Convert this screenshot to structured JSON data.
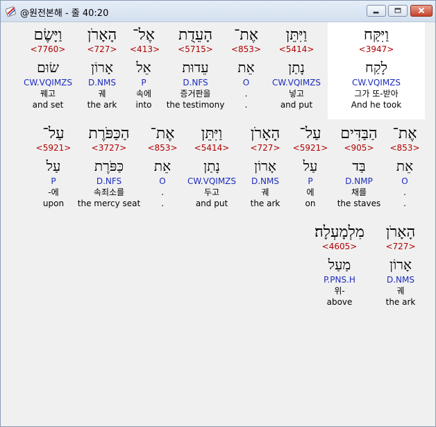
{
  "window": {
    "title": "@원전본해 - 줄 40:20"
  },
  "lines": [
    {
      "words": [
        {
          "heb": "וַיִּקַּח",
          "strong": "<3947>",
          "lemma": "לָקַח",
          "morph": "CW.VQIMZS",
          "kor": "그가 또-받아",
          "eng": "And he took",
          "selected": true
        },
        {
          "heb": "אֶת־",
          "strong": "<853>",
          "lemma": "אֵת",
          "morph": "O",
          "kor": ".",
          "eng": "."
        },
        {
          "heb": "וַיִּתֵּן",
          "strong": "<5414>",
          "lemma": "נָתַן",
          "morph": "CW.VQIMZS",
          "kor": "넣고",
          "eng": "and put"
        },
        {
          "heb": "הָעֵדֻת",
          "strong": "<5715>",
          "lemma": "עֵדוּת",
          "morph": "D.NFS",
          "kor": "증거판을",
          "eng": "the testimony"
        },
        {
          "heb": "אֶל־",
          "strong": "<413>",
          "lemma": "אֵל",
          "morph": "P",
          "kor": "속에",
          "eng": "into"
        },
        {
          "heb": "הָאָרֹן",
          "strong": "<727>",
          "lemma": "אָרוֹן",
          "morph": "D.NMS",
          "kor": "궤",
          "eng": "the ark"
        },
        {
          "heb": "וַיָּשֶׂם",
          "strong": "<7760>",
          "lemma": "שׂוּם",
          "morph": "CW.VQIMZS",
          "kor": "꿰고",
          "eng": "and set"
        }
      ]
    },
    {
      "words": [
        {
          "heb": "אֶת־",
          "strong": "<853>",
          "lemma": "אֵת",
          "morph": "O",
          "kor": ".",
          "eng": "."
        },
        {
          "heb": "הַבַּדִּים",
          "strong": "<905>",
          "lemma": "בַּד",
          "morph": "D.NMP",
          "kor": "채를",
          "eng": "the staves"
        },
        {
          "heb": "עַל־",
          "strong": "<5921>",
          "lemma": "עַל",
          "morph": "P",
          "kor": "에",
          "eng": "on"
        },
        {
          "heb": "הָאָרֹן",
          "strong": "<727>",
          "lemma": "אָרוֹן",
          "morph": "D.NMS",
          "kor": "궤",
          "eng": "the ark"
        },
        {
          "heb": "וַיִּתֵּן",
          "strong": "<5414>",
          "lemma": "נָתַן",
          "morph": "CW.VQIMZS",
          "kor": "두고",
          "eng": "and put"
        },
        {
          "heb": "אֶת־",
          "strong": "<853>",
          "lemma": "אֵת",
          "morph": "O",
          "kor": ".",
          "eng": "."
        },
        {
          "heb": "הַכַּפֹּרֶת",
          "strong": "<3727>",
          "lemma": "כַּפֹּרֶת",
          "morph": "D.NFS",
          "kor": "속죄소를",
          "eng": "the mercy seat"
        },
        {
          "heb": "עַל־",
          "strong": "<5921>",
          "lemma": "עַל",
          "morph": "P",
          "kor": "-에",
          "eng": "upon"
        }
      ]
    },
    {
      "words": [
        {
          "heb": "הָאָרֹן",
          "strong": "<727>",
          "lemma": "אָרוֹן",
          "morph": "D.NMS",
          "kor": "궤",
          "eng": "the ark"
        },
        {
          "heb": "מִלְמָעְלָה׃",
          "strong": "<4605>",
          "lemma": "מַעַל",
          "morph": "P.PNS.H",
          "kor": "위-",
          "eng": "above"
        }
      ]
    }
  ]
}
